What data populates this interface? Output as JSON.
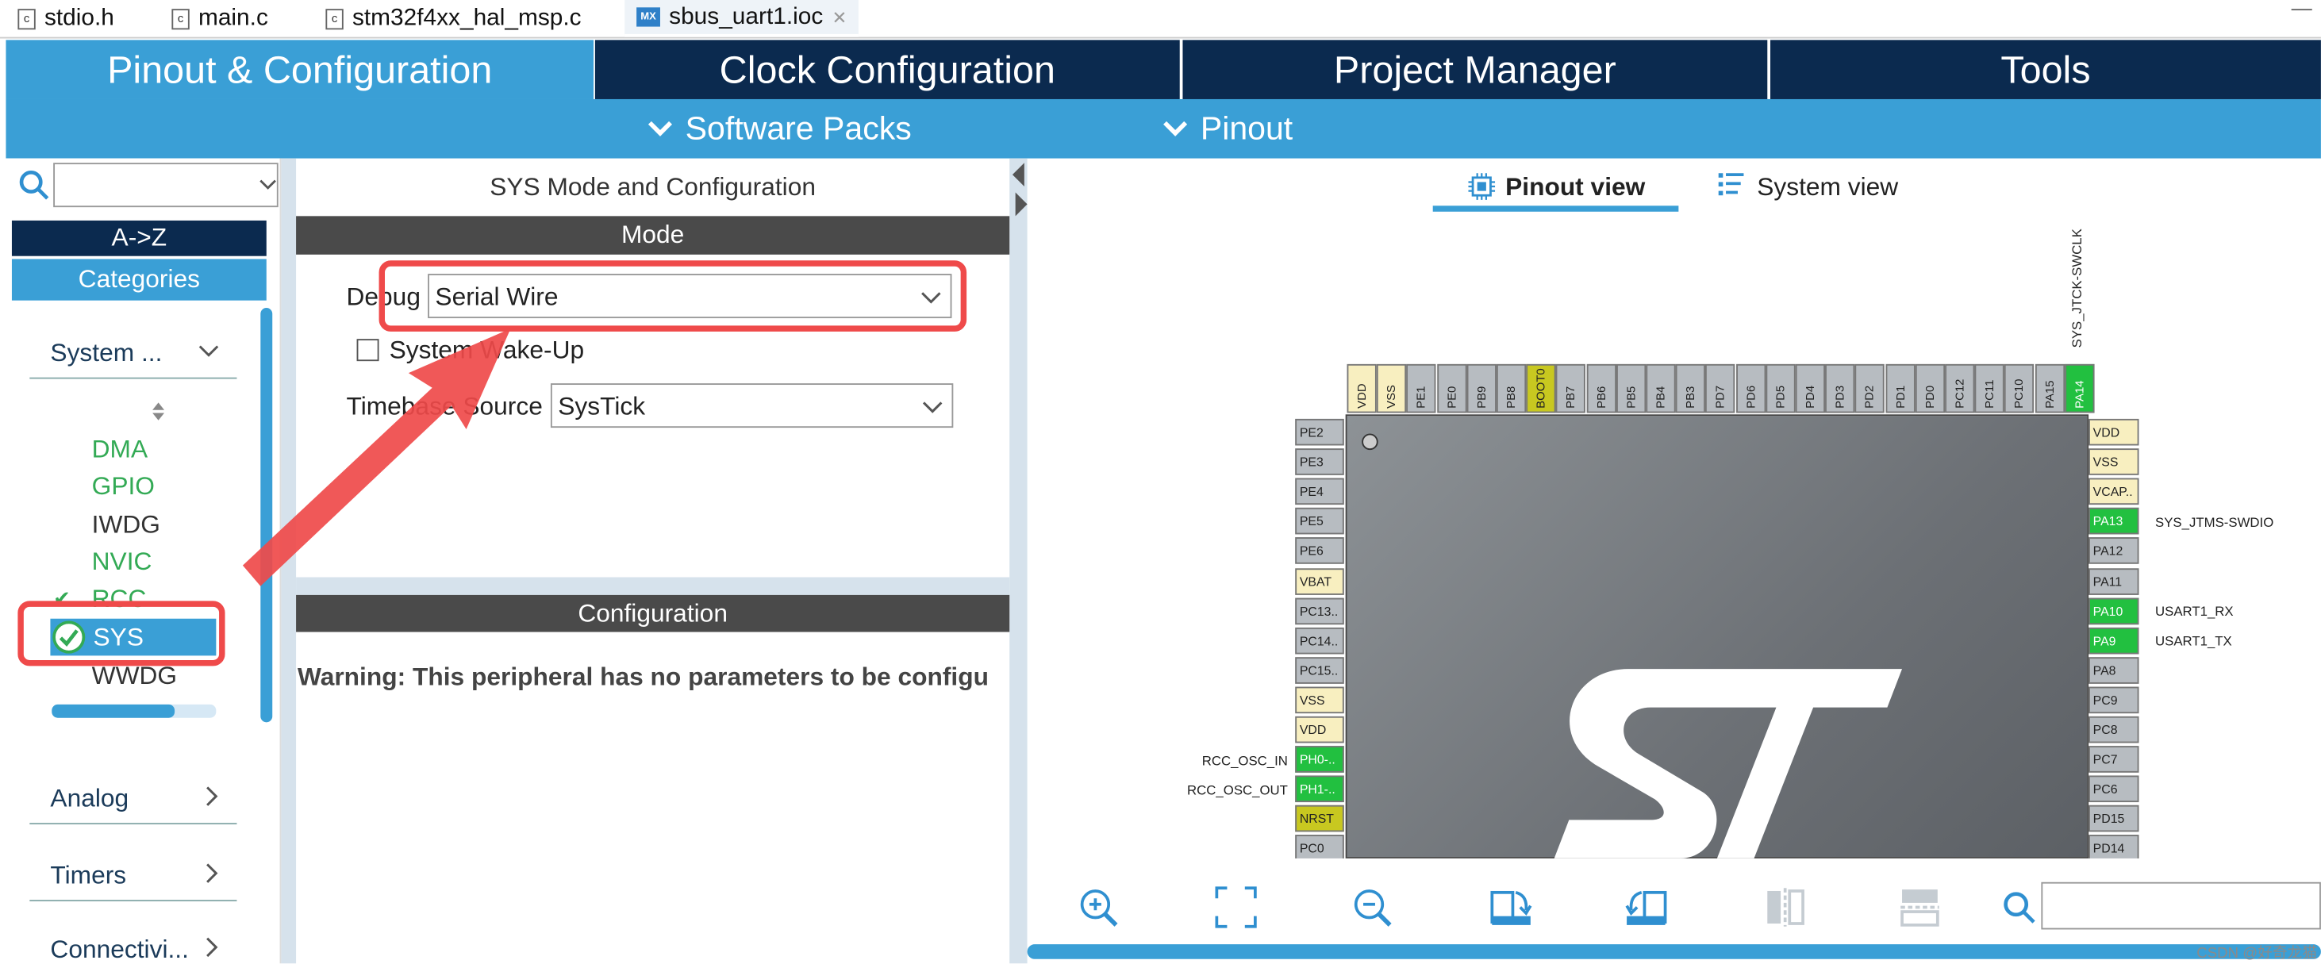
{
  "editor_tabs": [
    {
      "icon": "c",
      "label": "stdio.h"
    },
    {
      "icon": "c",
      "label": "main.c"
    },
    {
      "icon": "c",
      "label": "stm32f4xx_hal_msp.c"
    },
    {
      "icon": "MX",
      "label": "sbus_uart1.ioc",
      "close": "✕"
    }
  ],
  "top_tabs": [
    "Pinout & Configuration",
    "Clock Configuration",
    "Project Manager",
    "Tools"
  ],
  "subbar": {
    "software_packs": "Software Packs",
    "pinout": "Pinout"
  },
  "left": {
    "sort_az": "A->Z",
    "categories": "Categories",
    "group_system": "System ...",
    "items": [
      "DMA",
      "GPIO",
      "IWDG",
      "NVIC",
      "RCC",
      "SYS",
      "WWDG"
    ],
    "group_analog": "Analog",
    "group_timers": "Timers",
    "group_connectivity": "Connectivi..."
  },
  "mode": {
    "title": "SYS Mode and Configuration",
    "header": "Mode",
    "debug_label": "Debug",
    "debug_value": "Serial Wire",
    "wakeup_label": "System Wake-Up",
    "timebase_label": "Timebase Source",
    "timebase_value": "SysTick"
  },
  "config": {
    "header": "Configuration",
    "warning": "Warning: This peripheral has no parameters to be configu"
  },
  "view": {
    "pinout_view": "Pinout view",
    "system_view": "System view"
  },
  "pins": {
    "top": [
      "VDD",
      "VSS",
      "PE1",
      "PE0",
      "PB9",
      "PB8",
      "BOOT0",
      "PB7",
      "PB6",
      "PB5",
      "PB4",
      "PB3",
      "PD7",
      "PD6",
      "PD5",
      "PD4",
      "PD3",
      "PD2",
      "PD1",
      "PD0",
      "PC12",
      "PC11",
      "PC10",
      "PA15",
      "PA14"
    ],
    "left": [
      "PE2",
      "PE3",
      "PE4",
      "PE5",
      "PE6",
      "VBAT",
      "PC13..",
      "PC14..",
      "PC15..",
      "VSS",
      "VDD",
      "PH0-..",
      "PH1-..",
      "NRST",
      "PC0"
    ],
    "right": [
      "VDD",
      "VSS",
      "VCAP..",
      "PA13",
      "PA12",
      "PA11",
      "PA10",
      "PA9",
      "PA8",
      "PC9",
      "PC8",
      "PC7",
      "PC6",
      "PD15",
      "PD14"
    ],
    "labels": {
      "pa14": "SYS_JTCK-SWCLK",
      "pa13": "SYS_JTMS-SWDIO",
      "pa10": "USART1_RX",
      "pa9": "USART1_TX",
      "ph0": "RCC_OSC_IN",
      "ph1": "RCC_OSC_OUT"
    }
  },
  "watermark": "CSDN @好奇龙猫",
  "colors": {
    "navy": "#0b2a4f",
    "blue": "#3a9fd6",
    "green": "#22c040",
    "red_annotation": "#ef4a4a"
  }
}
